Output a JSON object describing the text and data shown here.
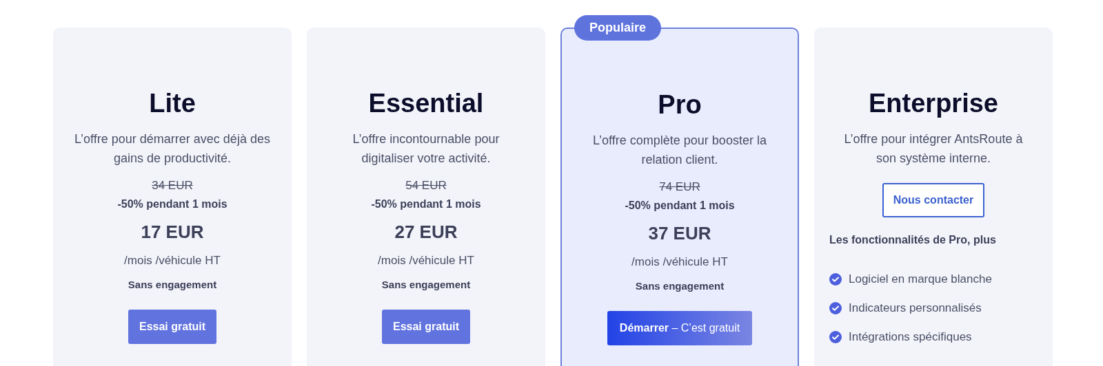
{
  "plans": [
    {
      "name": "Lite",
      "highlighted": false,
      "kind": "trial",
      "description": "L’offre pour démarrer avec déjà des gains de productivité.",
      "old_price": "34 EUR",
      "discount": "-50% pendant 1 mois",
      "price": "17 EUR",
      "unit": "/mois /véhicule HT",
      "commitment": "Sans engagement",
      "button": "Essai gratuit"
    },
    {
      "name": "Essential",
      "highlighted": false,
      "kind": "trial",
      "description": "L’offre incontournable pour digitaliser votre activité.",
      "old_price": "54 EUR",
      "discount": "-50% pendant 1 mois",
      "price": "27 EUR",
      "unit": "/mois /véhicule HT",
      "commitment": "Sans engagement",
      "button": "Essai gratuit"
    },
    {
      "name": "Pro",
      "highlighted": true,
      "badge": "Populaire",
      "kind": "start",
      "description": "L’offre complète pour booster la relation client.",
      "old_price": "74 EUR",
      "discount": "-50% pendant 1 mois",
      "price": "37 EUR",
      "unit": "/mois /véhicule HT",
      "commitment": "Sans engagement",
      "button": "**Démarrer** – C’est gratuit"
    },
    {
      "name": "Enterprise",
      "highlighted": false,
      "kind": "contact",
      "description": "L’offre pour intégrer AntsRoute à son système interne.",
      "button": "Nous contacter",
      "features_heading": "Les fonctionnalités de Pro, plus",
      "features": [
        "Logiciel en marque blanche",
        "Indicateurs personnalisés",
        "Intégrations spécifiques"
      ]
    }
  ]
}
